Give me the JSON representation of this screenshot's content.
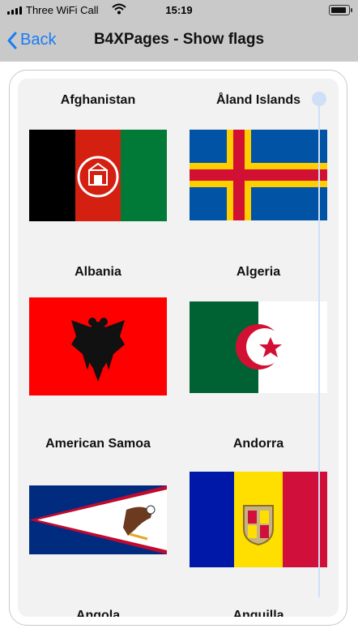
{
  "status_bar": {
    "carrier": "Three WiFi Call",
    "time": "15:19",
    "signal_bars": 4,
    "battery_level": 0.9,
    "icons": [
      "signal-bars-icon",
      "wifi-icon",
      "battery-icon"
    ]
  },
  "nav": {
    "back_label": "Back",
    "title": "B4XPages - Show flags",
    "back_icon": "chevron-left-icon",
    "accent_color": "#1a7cf5"
  },
  "flags": [
    {
      "name": "Afghanistan"
    },
    {
      "name": "Åland Islands"
    },
    {
      "name": "Albania"
    },
    {
      "name": "Algeria"
    },
    {
      "name": "American Samoa"
    },
    {
      "name": "Andorra"
    },
    {
      "name": "Angola"
    },
    {
      "name": "Anguilla"
    }
  ]
}
